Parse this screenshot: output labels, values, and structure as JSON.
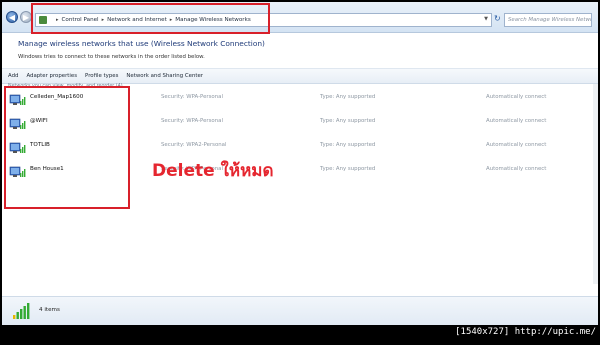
{
  "address_bar": {
    "crumbs": [
      "Control Panel",
      "Network and Internet",
      "Manage Wireless Networks"
    ],
    "search_placeholder": "Search Manage Wireless Networks"
  },
  "header": {
    "title": "Manage wireless networks that use (Wireless Network Connection)",
    "subtitle": "Windows tries to connect to these networks in the order listed below."
  },
  "toolbar": {
    "add": "Add",
    "adapter_properties": "Adapter properties",
    "profile_types": "Profile types",
    "network_sharing_center": "Network and Sharing Center"
  },
  "list": {
    "column_header": "Networks you can view, modify, and reorder (4)",
    "networks": [
      {
        "name": "Celleden_Map1600",
        "security": "Security: WPA-Personal",
        "type": "Type: Any supported",
        "mode": "Automatically connect"
      },
      {
        "name": "@WIFI",
        "security": "Security: WPA-Personal",
        "type": "Type: Any supported",
        "mode": "Automatically connect"
      },
      {
        "name": "TOTLIB",
        "security": "Security: WPA2-Personal",
        "type": "Type: Any supported",
        "mode": "Automatically connect"
      },
      {
        "name": "Ben House1",
        "security": "Security: WPA-Personal",
        "type": "Type: Any supported",
        "mode": "Automatically connect"
      }
    ]
  },
  "annotation": {
    "text": "Delete ให้หมด",
    "color": "#e5262f"
  },
  "status": {
    "items": "4 items"
  },
  "watermark": "[1540x727] http://upic.me/",
  "icons": {
    "network": "wireless-network-icon",
    "status": "wireless-signal-icon"
  }
}
